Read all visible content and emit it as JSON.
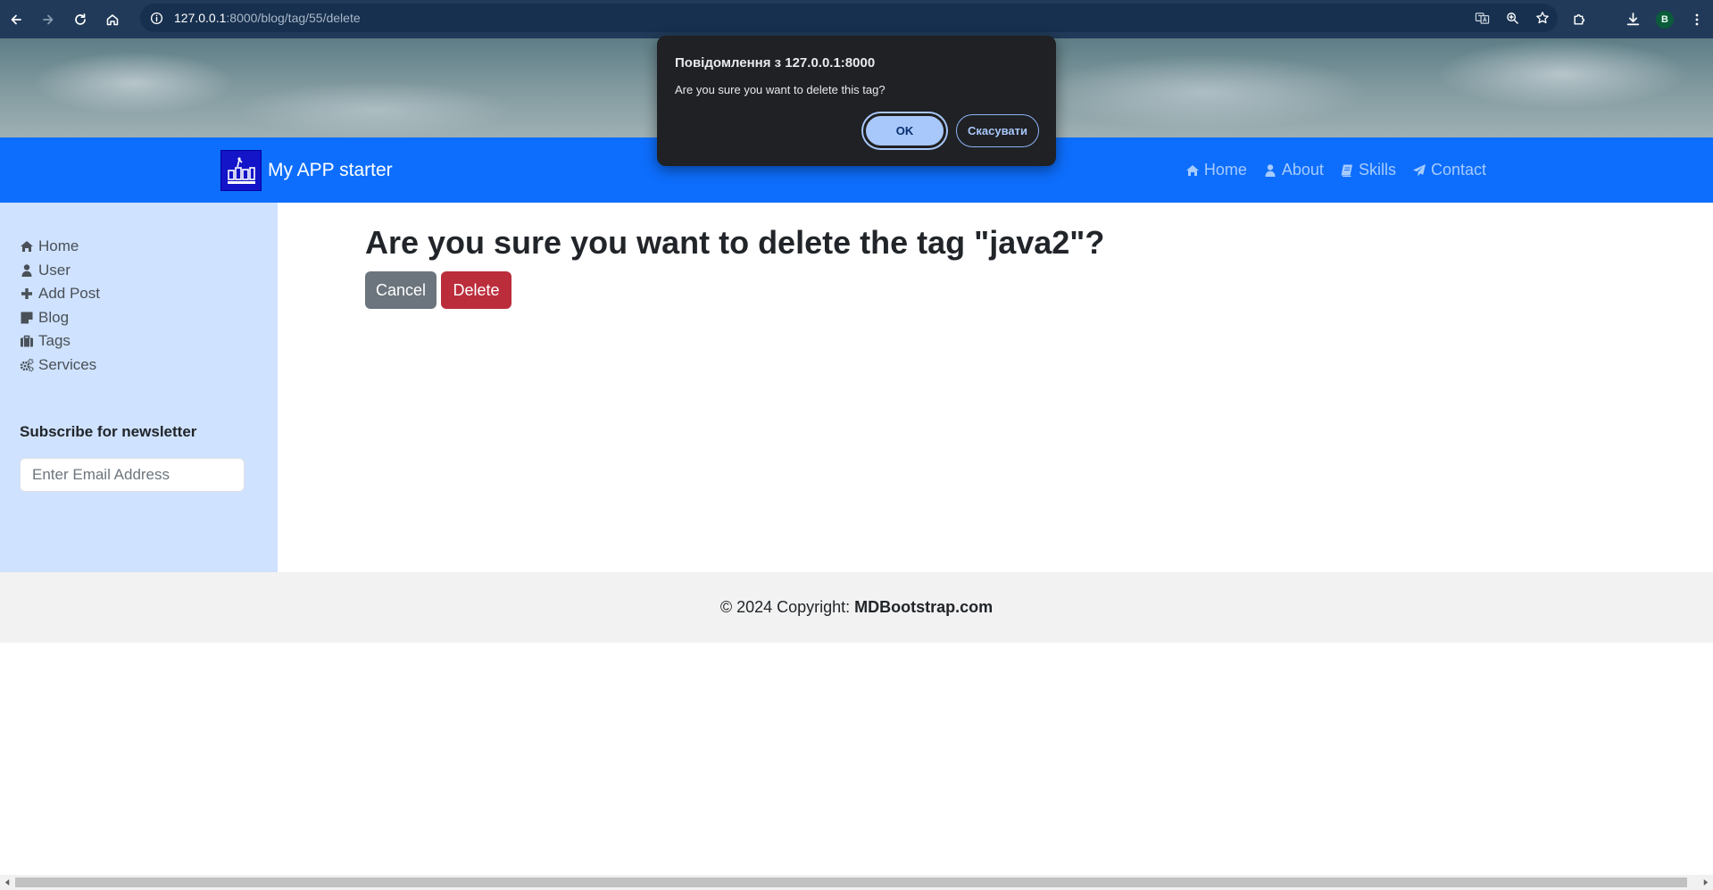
{
  "browser": {
    "url_host": "127.0.0.1",
    "url_path": ":8000/blog/tag/55/delete",
    "profile_initial": "B",
    "icons": [
      "back-icon",
      "forward-icon",
      "reload-icon",
      "home-icon",
      "info-icon",
      "translate-icon",
      "zoom-icon",
      "bookmark-star-icon",
      "extensions-icon",
      "download-icon",
      "menu-dots-icon"
    ]
  },
  "site": {
    "brand": "My APP starter",
    "nav": [
      {
        "label": "Home",
        "icon": "home-icon"
      },
      {
        "label": "About",
        "icon": "user-icon"
      },
      {
        "label": "Skills",
        "icon": "book-icon"
      },
      {
        "label": "Contact",
        "icon": "paper-plane-icon"
      }
    ]
  },
  "sidebar": {
    "items": [
      {
        "label": "Home",
        "icon": "home-icon"
      },
      {
        "label": "User",
        "icon": "user-icon"
      },
      {
        "label": "Add Post",
        "icon": "plus-icon"
      },
      {
        "label": "Blog",
        "icon": "sticky-note-icon"
      },
      {
        "label": "Tags",
        "icon": "briefcase-icon"
      },
      {
        "label": "Services",
        "icon": "cogs-icon"
      }
    ],
    "newsletter_title": "Subscribe for newsletter",
    "email_placeholder": "Enter Email Address"
  },
  "main": {
    "title": "Are you sure you want to delete the tag \"java2\"?",
    "cancel_label": "Cancel",
    "delete_label": "Delete"
  },
  "footer": {
    "copyright": "© 2024 Copyright:",
    "link": "MDBootstrap.com"
  },
  "dialog": {
    "title": "Повідомлення з 127.0.0.1:8000",
    "message": "Are you sure you want to delete this tag?",
    "ok_label": "OK",
    "cancel_label": "Скасувати"
  },
  "colors": {
    "navbar": "#0d6efd",
    "sidebar": "#cfe2ff",
    "cancel_button": "#6c757d",
    "delete_button": "#bb2d3b",
    "browser_chrome": "#213a59",
    "dialog_bg": "#202124"
  }
}
